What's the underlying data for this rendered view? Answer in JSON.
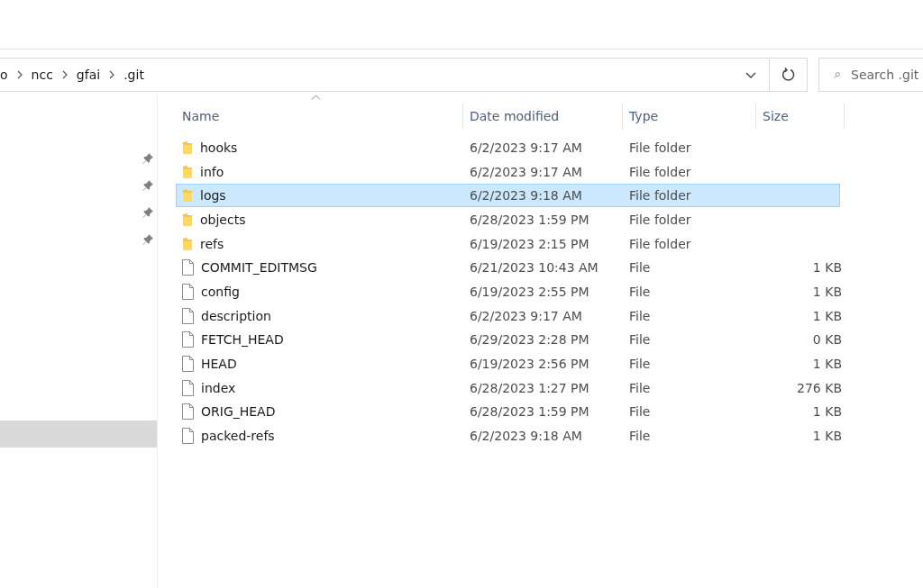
{
  "address_bar": {
    "crumbs": [
      "o",
      "ncc",
      "gfai",
      ".git"
    ]
  },
  "search": {
    "placeholder": "Search .git"
  },
  "sidebar": {
    "items": [
      {
        "kind": "pinned",
        "selected": false
      },
      {
        "kind": "pinned",
        "selected": false
      },
      {
        "kind": "pinned",
        "selected": false
      },
      {
        "kind": "pinned",
        "selected": false
      },
      {
        "kind": "blank",
        "selected": true
      }
    ]
  },
  "table": {
    "columns": [
      "Name",
      "Date modified",
      "Type",
      "Size"
    ],
    "rows": [
      {
        "kind": "folder",
        "name": "hooks",
        "date": "6/2/2023 9:17 AM",
        "type": "File folder",
        "selected": false
      },
      {
        "kind": "folder",
        "name": "info",
        "date": "6/2/2023 9:17 AM",
        "type": "File folder",
        "selected": false
      },
      {
        "kind": "folder",
        "name": "logs",
        "date": "6/2/2023 9:18 AM",
        "type": "File folder",
        "selected": true
      },
      {
        "kind": "folder",
        "name": "objects",
        "date": "6/28/2023 1:59 PM",
        "type": "File folder",
        "selected": false
      },
      {
        "kind": "folder",
        "name": "refs",
        "date": "6/19/2023 2:15 PM",
        "type": "File folder",
        "selected": false
      },
      {
        "kind": "file",
        "name": "COMMIT_EDITMSG",
        "date": "6/21/2023 10:43 AM",
        "type": "File",
        "size": "1 KB",
        "selected": false
      },
      {
        "kind": "file",
        "name": "config",
        "date": "6/19/2023 2:55 PM",
        "type": "File",
        "size": "1 KB",
        "selected": false
      },
      {
        "kind": "file",
        "name": "description",
        "date": "6/2/2023 9:17 AM",
        "type": "File",
        "size": "1 KB",
        "selected": false
      },
      {
        "kind": "file",
        "name": "FETCH_HEAD",
        "date": "6/29/2023 2:28 PM",
        "type": "File",
        "size": "0 KB",
        "selected": false
      },
      {
        "kind": "file",
        "name": "HEAD",
        "date": "6/19/2023 2:56 PM",
        "type": "File",
        "size": "1 KB",
        "selected": false
      },
      {
        "kind": "file",
        "name": "index",
        "date": "6/28/2023 1:27 PM",
        "type": "File",
        "size": "276 KB",
        "selected": false
      },
      {
        "kind": "file",
        "name": "ORIG_HEAD",
        "date": "6/28/2023 1:59 PM",
        "type": "File",
        "size": "1 KB",
        "selected": false
      },
      {
        "kind": "file",
        "name": "packed-refs",
        "date": "6/2/2023 9:18 AM",
        "type": "File",
        "size": "1 KB",
        "selected": false
      }
    ]
  }
}
